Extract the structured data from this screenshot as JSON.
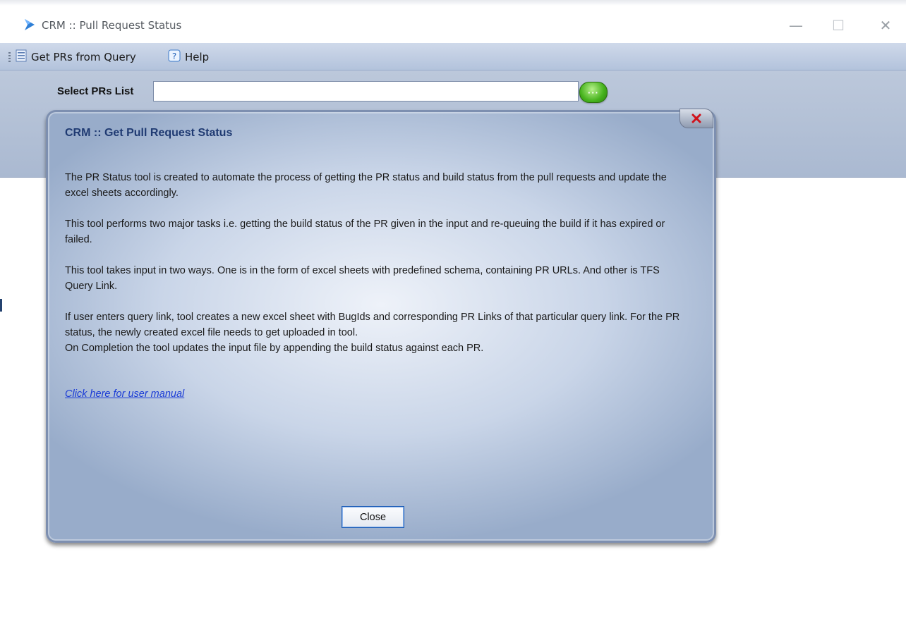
{
  "window": {
    "title": "CRM :: Pull Request Status",
    "minimize_glyph": "—",
    "maximize_glyph": "☐",
    "close_glyph": "✕"
  },
  "toolbar": {
    "items": [
      {
        "label": "Get PRs from Query",
        "icon": "document-list-icon"
      },
      {
        "label": "Help",
        "icon": "help-icon"
      }
    ]
  },
  "selector": {
    "label": "Select PRs List",
    "value": "",
    "button_glyph": "···"
  },
  "dialog": {
    "title": "CRM :: Get Pull Request Status",
    "paragraphs": [
      "The PR Status tool is created to automate the process of getting the PR status and build status from the pull requests and update the excel sheets accordingly.",
      "This tool performs two major tasks i.e. getting the build status of the PR given in the input and re-queuing the build if it has expired or failed.",
      "This tool takes input in two ways. One is in the form of excel sheets with predefined schema, containing PR URLs. And other is TFS Query Link.",
      "If user enters query link, tool creates a new excel sheet with BugIds and corresponding PR Links of that particular query link. For the PR status, the newly created excel file needs to get uploaded in tool.\nOn Completion the tool updates the input file by appending the build status against each PR."
    ],
    "link_text": "Click here for user manual",
    "close_label": "Close"
  },
  "colors": {
    "accent": "#1f3a72",
    "link": "#1b3cd6",
    "toolbar_bg": "#c3d0e5",
    "header_bg": "#b3c1d8"
  }
}
